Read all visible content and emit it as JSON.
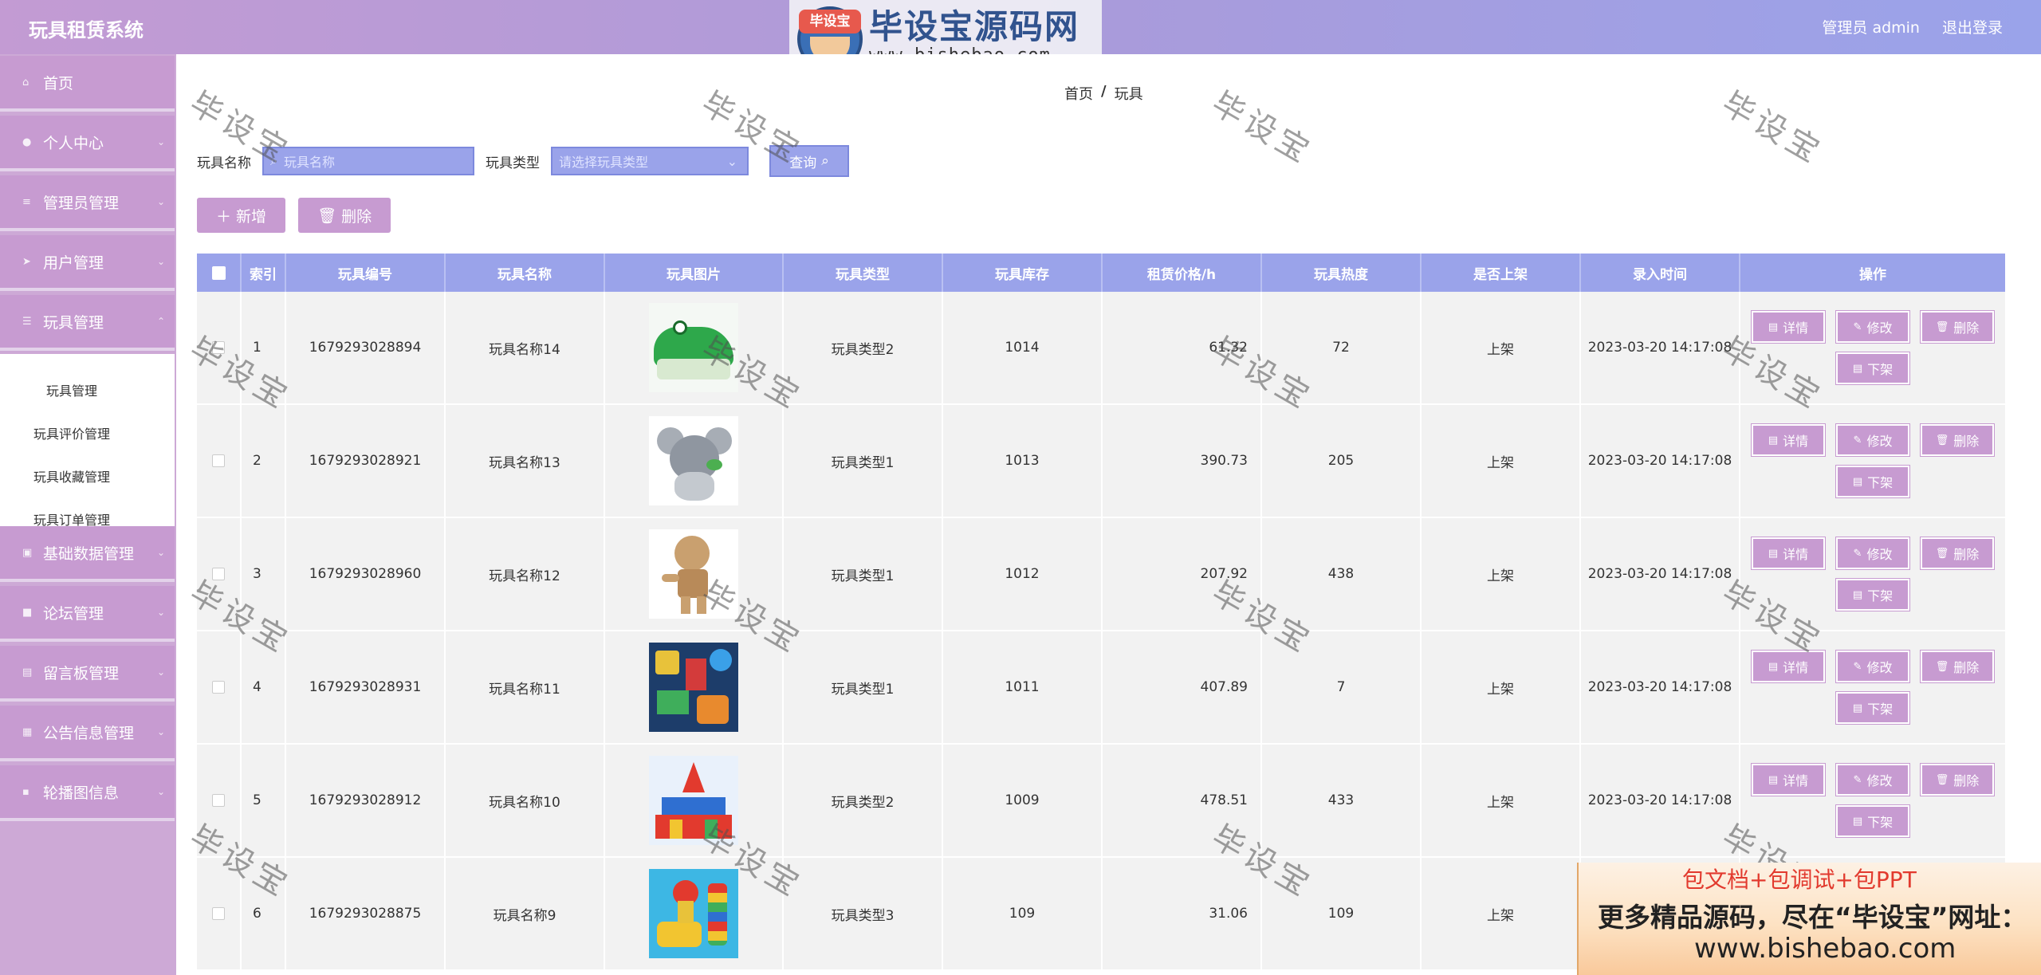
{
  "header": {
    "app_title": "玩具租赁系统",
    "admin_label": "管理员 admin",
    "logout_label": "退出登录"
  },
  "logo": {
    "badge_text": "毕设宝",
    "main_text": "毕设宝源码网",
    "url": "www.bishebao.com"
  },
  "sidebar": {
    "items": [
      {
        "label": "首页",
        "icon": "home-icon"
      },
      {
        "label": "个人中心",
        "icon": "user-icon"
      },
      {
        "label": "管理员管理",
        "icon": "sliders-icon"
      },
      {
        "label": "用户管理",
        "icon": "send-icon"
      },
      {
        "label": "玩具管理",
        "icon": "menu-icon"
      },
      {
        "label": "基础数据管理",
        "icon": "delete-icon"
      },
      {
        "label": "论坛管理",
        "icon": "doc-icon"
      },
      {
        "label": "留言板管理",
        "icon": "list-icon"
      },
      {
        "label": "公告信息管理",
        "icon": "grid-icon"
      },
      {
        "label": "轮播图信息",
        "icon": "chat-icon"
      }
    ],
    "submenu": [
      {
        "label": "玩具管理"
      },
      {
        "label": "玩具评价管理"
      },
      {
        "label": "玩具收藏管理"
      },
      {
        "label": "玩具订单管理"
      }
    ]
  },
  "breadcrumb": {
    "home": "首页",
    "separator": "/",
    "current": "玩具"
  },
  "search": {
    "name_label": "玩具名称",
    "name_placeholder": "玩具名称",
    "type_label": "玩具类型",
    "type_placeholder": "请选择玩具类型",
    "search_button": "查询"
  },
  "actions": {
    "add": "新增",
    "delete": "删除"
  },
  "table": {
    "headers": [
      "索引",
      "玩具编号",
      "玩具名称",
      "玩具图片",
      "玩具类型",
      "玩具库存",
      "租赁价格/h",
      "玩具热度",
      "是否上架",
      "录入时间",
      "操作"
    ],
    "op_labels": {
      "detail": "详情",
      "edit": "修改",
      "delete": "删除",
      "offshelf": "下架"
    },
    "rows": [
      {
        "index": "1",
        "code": "1679293028894",
        "name": "玩具名称14",
        "image": "crocodile",
        "type": "玩具类型2",
        "stock": "1014",
        "price": "61.32",
        "heat": "72",
        "shelf": "上架",
        "time": "2023-03-20 14:17:08"
      },
      {
        "index": "2",
        "code": "1679293028921",
        "name": "玩具名称13",
        "image": "koala",
        "type": "玩具类型1",
        "stock": "1013",
        "price": "390.73",
        "heat": "205",
        "shelf": "上架",
        "time": "2023-03-20 14:17:08"
      },
      {
        "index": "3",
        "code": "1679293028960",
        "name": "玩具名称12",
        "image": "wooden-doll",
        "type": "玩具类型1",
        "stock": "1012",
        "price": "207.92",
        "heat": "438",
        "shelf": "上架",
        "time": "2023-03-20 14:17:08"
      },
      {
        "index": "4",
        "code": "1679293028931",
        "name": "玩具名称11",
        "image": "toy-pile",
        "type": "玩具类型1",
        "stock": "1011",
        "price": "407.89",
        "heat": "7",
        "shelf": "上架",
        "time": "2023-03-20 14:17:08"
      },
      {
        "index": "5",
        "code": "1679293028912",
        "name": "玩具名称10",
        "image": "block-castle",
        "type": "玩具类型2",
        "stock": "1009",
        "price": "478.51",
        "heat": "433",
        "shelf": "上架",
        "time": "2023-03-20 14:17:08"
      },
      {
        "index": "6",
        "code": "1679293028875",
        "name": "玩具名称9",
        "image": "stacking-toy",
        "type": "玩具类型3",
        "stock": "109",
        "price": "31.06",
        "heat": "109",
        "shelf": "上架",
        "time": ""
      }
    ]
  },
  "watermark": "毕设宝",
  "promo": {
    "line1": "包文档+包调试+包PPT",
    "line2": "更多精品源码，尽在“毕设宝”网址：",
    "line3": "www.bishebao.com"
  },
  "colors": {
    "accent": "#c79bd1",
    "table_header": "#9aa3ea",
    "header_gradient_start": "#c39bd3",
    "header_gradient_end": "#9aa3ea"
  }
}
